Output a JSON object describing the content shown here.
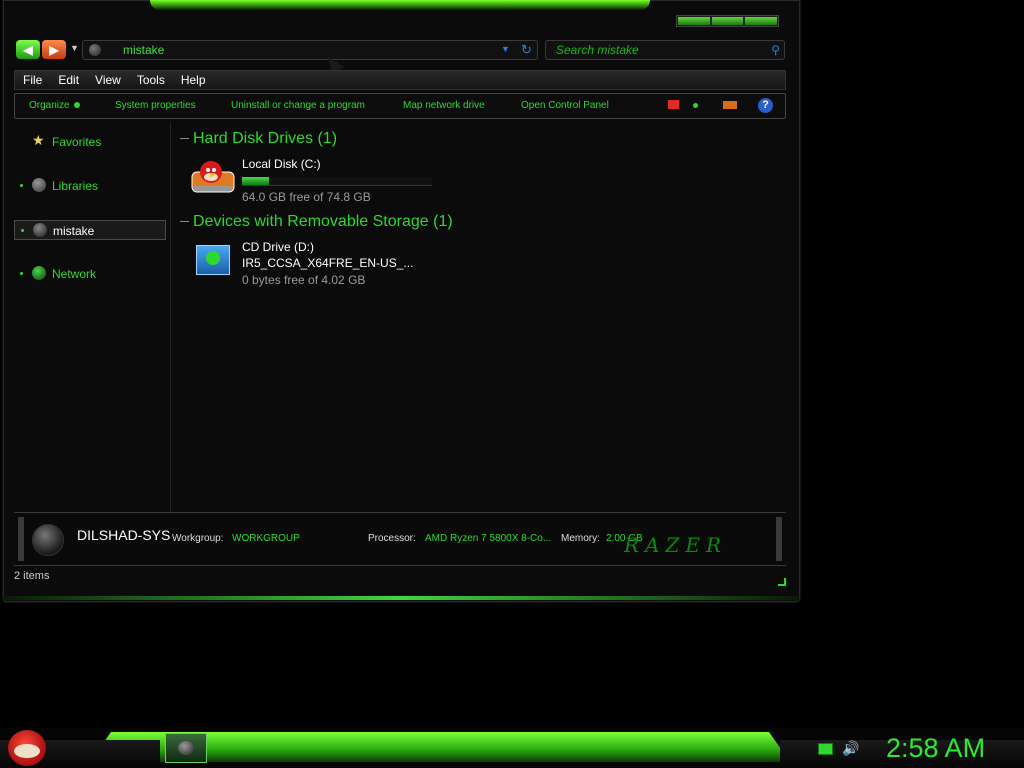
{
  "window": {
    "address_text": "mistake",
    "search_placeholder": "Search mistake"
  },
  "menu": [
    "File",
    "Edit",
    "View",
    "Tools",
    "Help"
  ],
  "commands": {
    "organize": "Organize",
    "system_properties": "System properties",
    "uninstall": "Uninstall or change a program",
    "map_drive": "Map network drive",
    "control_panel": "Open Control Panel"
  },
  "nav": {
    "favorites": "Favorites",
    "libraries": "Libraries",
    "computer": "mistake",
    "network": "Network"
  },
  "groups": {
    "hdd_title": "Hard Disk Drives (1)",
    "removable_title": "Devices with Removable Storage (1)"
  },
  "drives": {
    "local": {
      "name": "Local Disk (C:)",
      "free": "64.0 GB free of 74.8 GB",
      "used_fraction": 0.144
    },
    "cd": {
      "name": "CD Drive (D:)",
      "label": "IR5_CCSA_X64FRE_EN-US_...",
      "free": "0 bytes free of 4.02 GB"
    }
  },
  "details": {
    "computer_name": "DILSHAD-SYS",
    "workgroup_label": "Workgroup:",
    "workgroup_value": "WORKGROUP",
    "processor_label": "Processor:",
    "processor_value": "AMD Ryzen 7 5800X 8-Co...",
    "memory_label": "Memory:",
    "memory_value": "2.00 GB",
    "brand": "RAZER"
  },
  "status": {
    "items": "2 items"
  },
  "taskbar": {
    "clock": "2:58 AM"
  },
  "colors": {
    "accent": "#2fd82f",
    "background": "#000000"
  }
}
